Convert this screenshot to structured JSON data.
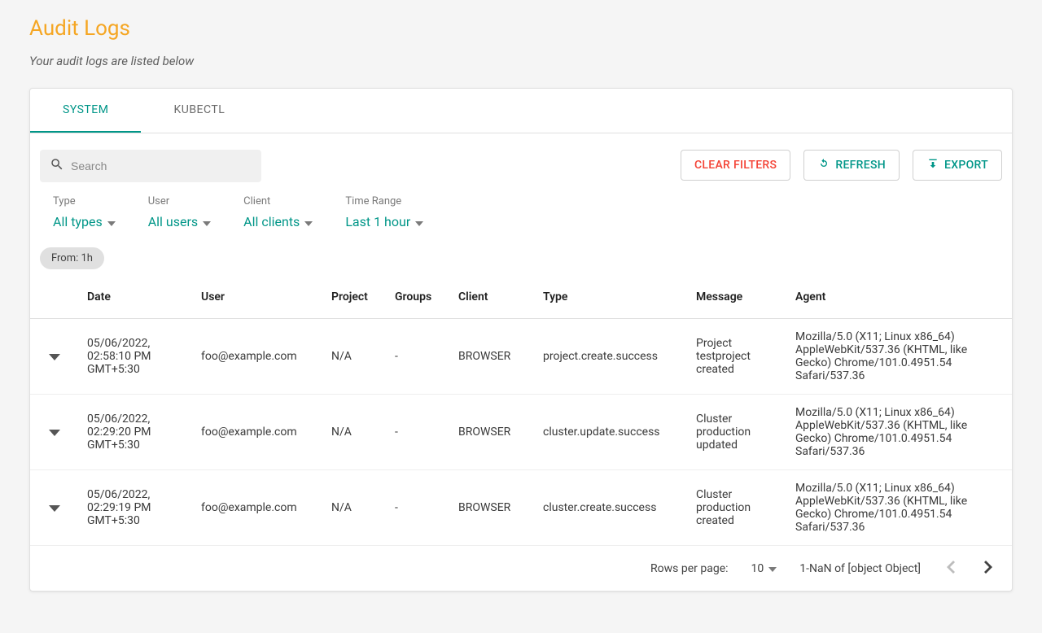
{
  "page": {
    "title": "Audit Logs",
    "subtitle": "Your audit logs are listed below"
  },
  "tabs": {
    "system": "SYSTEM",
    "kubectl": "KUBECTL"
  },
  "toolbar": {
    "search_placeholder": "Search",
    "clear_filters": "CLEAR FILTERS",
    "refresh": "REFRESH",
    "export": "EXPORT"
  },
  "filters": {
    "type": {
      "label": "Type",
      "value": "All types"
    },
    "user": {
      "label": "User",
      "value": "All users"
    },
    "client": {
      "label": "Client",
      "value": "All clients"
    },
    "time_range": {
      "label": "Time Range",
      "value": "Last 1 hour"
    }
  },
  "chip": "From: 1h",
  "columns": {
    "date": "Date",
    "user": "User",
    "project": "Project",
    "groups": "Groups",
    "client": "Client",
    "type": "Type",
    "message": "Message",
    "agent": "Agent"
  },
  "rows": [
    {
      "date": "05/06/2022, 02:58:10 PM GMT+5:30",
      "user": "foo@example.com",
      "project": "N/A",
      "groups": "-",
      "client": "BROWSER",
      "type": "project.create.success",
      "message": "Project testproject created",
      "agent": "Mozilla/5.0 (X11; Linux x86_64) AppleWebKit/537.36 (KHTML, like Gecko) Chrome/101.0.4951.54 Safari/537.36"
    },
    {
      "date": "05/06/2022, 02:29:20 PM GMT+5:30",
      "user": "foo@example.com",
      "project": "N/A",
      "groups": "-",
      "client": "BROWSER",
      "type": "cluster.update.success",
      "message": "Cluster production updated",
      "agent": "Mozilla/5.0 (X11; Linux x86_64) AppleWebKit/537.36 (KHTML, like Gecko) Chrome/101.0.4951.54 Safari/537.36"
    },
    {
      "date": "05/06/2022, 02:29:19 PM GMT+5:30",
      "user": "foo@example.com",
      "project": "N/A",
      "groups": "-",
      "client": "BROWSER",
      "type": "cluster.create.success",
      "message": "Cluster production created",
      "agent": "Mozilla/5.0 (X11; Linux x86_64) AppleWebKit/537.36 (KHTML, like Gecko) Chrome/101.0.4951.54 Safari/537.36"
    }
  ],
  "pagination": {
    "rows_label": "Rows per page:",
    "rows_value": "10",
    "range": "1-NaN of [object Object]"
  }
}
